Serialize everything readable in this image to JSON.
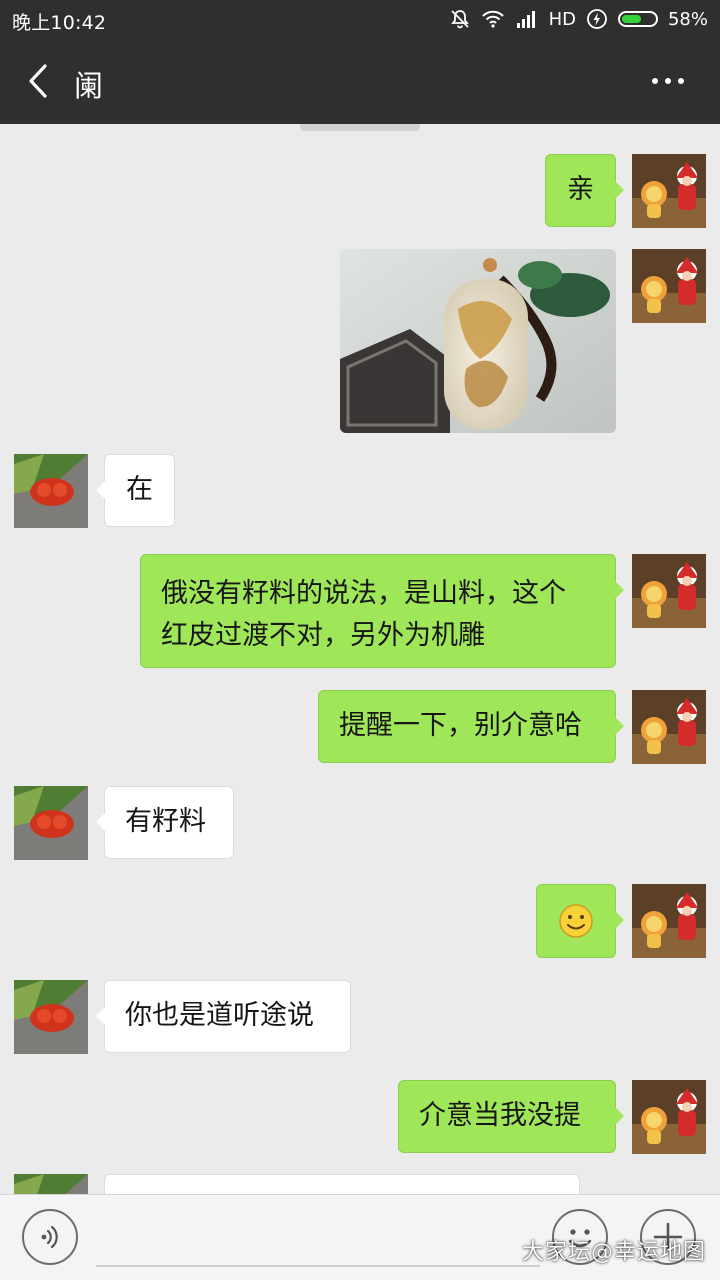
{
  "status_bar": {
    "time": "晚上10:42",
    "network": "HD",
    "battery_percent_label": "58%",
    "battery_level": 0.58,
    "icons": [
      "alarm-off-icon",
      "wifi-icon",
      "signal-icon",
      "charging-icon",
      "battery-icon"
    ]
  },
  "header": {
    "title": "阑",
    "back_icon": "chevron-left-icon",
    "more_icon": "more-dots-icon"
  },
  "messages": [
    {
      "side": "me",
      "type": "text",
      "text": "亲"
    },
    {
      "side": "me",
      "type": "image",
      "image": "jade-pendant-photo"
    },
    {
      "side": "them",
      "type": "text",
      "text": "在"
    },
    {
      "side": "me",
      "type": "text",
      "lines": [
        "俄没有籽料的说法，是山料，这个",
        "红皮过渡不对，另外为机雕"
      ]
    },
    {
      "side": "me",
      "type": "text",
      "text": "提醒一下，别介意哈"
    },
    {
      "side": "them",
      "type": "text",
      "text": "有籽料"
    },
    {
      "side": "me",
      "type": "emoji",
      "emoji": "smile-emoji"
    },
    {
      "side": "them",
      "type": "text",
      "text": "你也是道听途说"
    },
    {
      "side": "me",
      "type": "text",
      "text": "介意当我没提"
    },
    {
      "side": "them",
      "type": "text",
      "text": ""
    }
  ],
  "input_bar": {
    "voice_icon": "voice-icon",
    "input_value": "",
    "emoji_icon": "emoji-icon",
    "plus_icon": "plus-icon"
  },
  "watermark": "大家坛@幸运地图",
  "colors": {
    "header_bg": "#2f2f2f",
    "chat_bg": "#ebebeb",
    "my_bubble": "#9fe658",
    "their_bubble": "#ffffff",
    "battery_fill": "#35d13b"
  }
}
